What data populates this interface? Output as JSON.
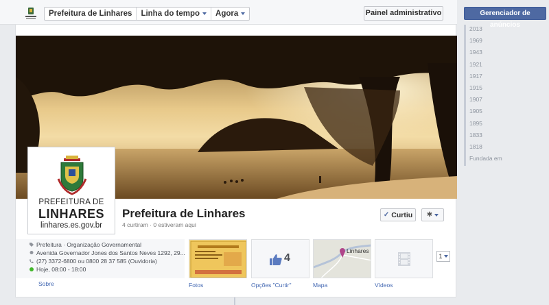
{
  "topbar": {
    "nav": [
      {
        "label": "Prefeitura de Linhares",
        "dropdown": false
      },
      {
        "label": "Linha do tempo",
        "dropdown": true
      },
      {
        "label": "Agora",
        "dropdown": true
      }
    ],
    "admin_label": "Painel administrativo"
  },
  "sidebar": {
    "ads_label": "Gerenciador de anúncios",
    "years": [
      "2013",
      "1969",
      "1943",
      "1921",
      "1917",
      "1915",
      "1907",
      "1905",
      "1895",
      "1833",
      "1818",
      "Fundada em"
    ]
  },
  "profile": {
    "line1": "PREFEITURA DE",
    "line2": "LINHARES",
    "line3": "linhares.es.gov.br"
  },
  "page": {
    "name": "Prefeitura de Linhares",
    "stats": "4 curtiram · 0 estiveram aqui",
    "liked_label": "Curtiu"
  },
  "about": {
    "category": "Prefeitura · Organização Governamental",
    "address": "Avenida Governador Jones dos Santos Neves 1292, 29...",
    "phone": "(27) 3372-6800 ou 0800 28 37 585 (Ouvidoria)",
    "hours": "Hoje, 08:00 - 18:00",
    "link": "Sobre"
  },
  "apps": {
    "photos_label": "Fotos",
    "likes_label": "Opções \"Curtir\"",
    "likes_count": "4",
    "map_label": "Mapa",
    "map_city": "Linhares",
    "videos_label": "Vídeos",
    "more_count": "1"
  },
  "colors": {
    "brand": "#3b5998",
    "link": "#4267b2",
    "hours_dot": "#42b72a"
  }
}
